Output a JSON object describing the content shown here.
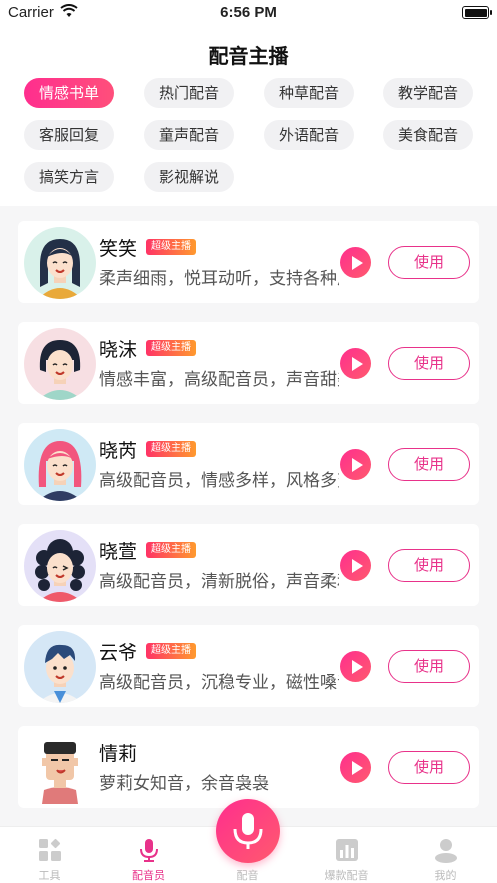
{
  "status": {
    "carrier": "Carrier",
    "time": "6:56 PM"
  },
  "header": {
    "title": "配音主播"
  },
  "categories": [
    {
      "label": "情感书单",
      "active": true
    },
    {
      "label": "热门配音"
    },
    {
      "label": "种草配音"
    },
    {
      "label": "教学配音"
    },
    {
      "label": "客服回复"
    },
    {
      "label": "童声配音"
    },
    {
      "label": "外语配音"
    },
    {
      "label": "美食配音"
    },
    {
      "label": "搞笑方言"
    },
    {
      "label": "影视解说"
    }
  ],
  "anchors": [
    {
      "name": "笑笑",
      "badge": "超级主播",
      "desc": "柔声细雨，悦耳动听，支持各种风格",
      "action": "使用"
    },
    {
      "name": "晓沫",
      "badge": "超级主播",
      "desc": "情感丰富，高级配音员，声音甜美",
      "action": "使用"
    },
    {
      "name": "晓芮",
      "badge": "超级主播",
      "desc": "高级配音员，情感多样，风格多变",
      "action": "使用"
    },
    {
      "name": "晓萱",
      "badge": "超级主播",
      "desc": "高级配音员，清新脱俗，声音柔和",
      "action": "使用"
    },
    {
      "name": "云爷",
      "badge": "超级主播",
      "desc": "高级配音员，沉稳专业，磁性嗓音",
      "action": "使用"
    },
    {
      "name": "情莉",
      "badge": "",
      "desc": "萝莉女知音，余音袅袅",
      "action": "使用"
    }
  ],
  "tabbar": [
    {
      "label": "工具",
      "icon": "tools-icon"
    },
    {
      "label": "配音员",
      "icon": "mic-icon",
      "active": true
    },
    {
      "label": "配音",
      "icon": "mic-center-icon"
    },
    {
      "label": "爆款配音",
      "icon": "chart-icon"
    },
    {
      "label": "我的",
      "icon": "user-icon"
    }
  ],
  "colors": {
    "accent": "#e8328a",
    "gradient_start": "#ff2e8e",
    "badge_end": "#ff9a2e"
  }
}
